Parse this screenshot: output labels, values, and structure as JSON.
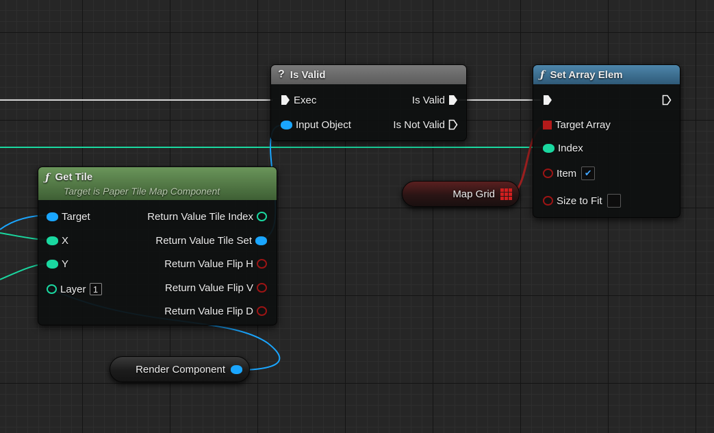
{
  "colors": {
    "exec_wire": "#d8d8d8",
    "object_wire": "#1aa6ff",
    "int_wire": "#1ad8a0",
    "array_wire": "#9b1f1f",
    "get_tile_header": "#4f7a3e",
    "is_valid_header": "#6b6b6b",
    "set_array_header": "#3f6f8f"
  },
  "is_valid": {
    "title": "Is Valid",
    "icon": "question-mark-icon",
    "exec_in": "Exec",
    "input_object": "Input Object",
    "is_valid_out": "Is Valid",
    "is_not_valid_out": "Is Not Valid"
  },
  "set_array": {
    "title": "Set Array Elem",
    "icon": "function-icon",
    "target_array": "Target Array",
    "index": "Index",
    "item": "Item",
    "item_checked": "✔",
    "size_to_fit": "Size to Fit"
  },
  "get_tile": {
    "title": "Get Tile",
    "subtitle": "Target is Paper Tile Map Component",
    "icon": "function-icon",
    "inputs": {
      "target": "Target",
      "x": "X",
      "y": "Y",
      "layer": "Layer",
      "layer_value": "1"
    },
    "outputs": {
      "tile_index": "Return Value Tile Index",
      "tile_set": "Return Value Tile Set",
      "flip_h": "Return Value Flip H",
      "flip_v": "Return Value Flip V",
      "flip_d": "Return Value Flip D"
    }
  },
  "variables": {
    "map_grid": "Map Grid",
    "render_component": "Render Component"
  }
}
